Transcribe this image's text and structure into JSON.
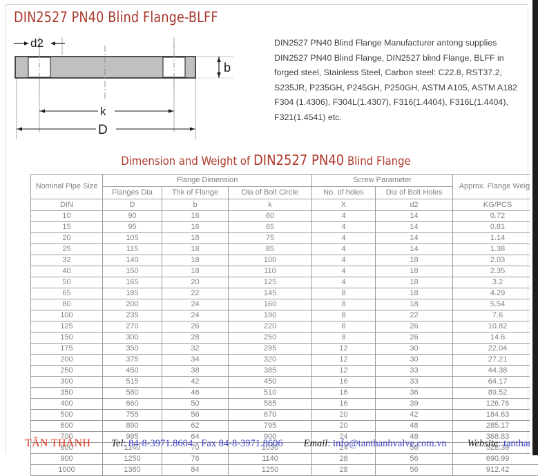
{
  "page": {
    "title": "DIN2527 PN40 Blind Flange-BLFF",
    "accent_color": "#a8392c",
    "heading_color": "#b03a2b"
  },
  "diagram": {
    "name": "blind-flange-cross-section",
    "labels": {
      "d2": "d2",
      "b": "b",
      "k": "k",
      "D": "D"
    }
  },
  "description": {
    "lines": [
      "DIN2527 PN40 Blind Flange Manufacturer antong supplies",
      "DIN2527 PN40 Blind Flange, DIN2527 blind Flange, BLFF in",
      "forged steel, Stainless Steel, Carbon steel: C22.8, RST37.2,",
      "S235JR, P235GH, P245GH, P250GH, ASTM A105, ASTM A182",
      "F304 (1.4306), F304L(1.4307), F316(1.4404), F316L(1.4404),",
      "F321(1.4541) etc."
    ]
  },
  "section_heading": {
    "prefix": "Dimension and Weight of ",
    "emphasis": "DIN2527 PN40",
    "suffix": " Blind Flange"
  },
  "table": {
    "group_headers": {
      "nominal_pipe_size": "Nominal Pipe Size",
      "flange_dimension": "Flange Dimension",
      "screw_parameter": "Screw Parameter",
      "approx_flange_weight": "Approx. Flange Weight"
    },
    "sub_headers": {
      "flanges_dia": "Flanges Dia",
      "thk_of_flange": "Thk of Flange",
      "dia_of_bolt_circle": "Dia of Bolt Circle",
      "no_of_holes": "No. of holes",
      "dia_of_bolt_holes": "Dia of Bolt Holes"
    },
    "symbol_row": [
      "DIN",
      "D",
      "b",
      "k",
      "X",
      "d2",
      "KG/PCS"
    ],
    "rows": [
      [
        "10",
        "90",
        "16",
        "60",
        "4",
        "14",
        "0.72"
      ],
      [
        "15",
        "95",
        "16",
        "65",
        "4",
        "14",
        "0.81"
      ],
      [
        "20",
        "105",
        "18",
        "75",
        "4",
        "14",
        "1.14"
      ],
      [
        "25",
        "115",
        "18",
        "85",
        "4",
        "14",
        "1.38"
      ],
      [
        "32",
        "140",
        "18",
        "100",
        "4",
        "18",
        "2.03"
      ],
      [
        "40",
        "150",
        "18",
        "110",
        "4",
        "18",
        "2.35"
      ],
      [
        "50",
        "165",
        "20",
        "125",
        "4",
        "18",
        "3.2"
      ],
      [
        "65",
        "185",
        "22",
        "145",
        "8",
        "18",
        "4.29"
      ],
      [
        "80",
        "200",
        "24",
        "160",
        "8",
        "18",
        "5.54"
      ],
      [
        "100",
        "235",
        "24",
        "190",
        "8",
        "22",
        "7.6"
      ],
      [
        "125",
        "270",
        "26",
        "220",
        "8",
        "26",
        "10.82"
      ],
      [
        "150",
        "300",
        "28",
        "250",
        "8",
        "26",
        "14.6"
      ],
      [
        "175",
        "350",
        "32",
        "295",
        "12",
        "30",
        "22.04"
      ],
      [
        "200",
        "375",
        "34",
        "320",
        "12",
        "30",
        "27.21"
      ],
      [
        "250",
        "450",
        "38",
        "385",
        "12",
        "33",
        "44.38"
      ],
      [
        "300",
        "515",
        "42",
        "450",
        "16",
        "33",
        "64.17"
      ],
      [
        "350",
        "580",
        "46",
        "510",
        "16",
        "36",
        "89.52"
      ],
      [
        "400",
        "660",
        "50",
        "585",
        "16",
        "39",
        "126.76"
      ],
      [
        "500",
        "755",
        "56",
        "670",
        "20",
        "42",
        "184.63"
      ],
      [
        "600",
        "890",
        "62",
        "795",
        "20",
        "48",
        "285.17"
      ],
      [
        "700",
        "995",
        "64",
        "900",
        "24",
        "48",
        "368.83"
      ],
      [
        "800",
        "1140",
        "70",
        "1030",
        "24",
        "56",
        "528.39"
      ],
      [
        "900",
        "1250",
        "76",
        "1140",
        "28",
        "56",
        "690.99"
      ],
      [
        "1000",
        "1360",
        "84",
        "1250",
        "28",
        "56",
        "912.42"
      ]
    ]
  },
  "footer": {
    "brand": "TÂN THÀNH",
    "tel_label": "Tel",
    "tel_value": ": 84-8-3971.8604 - Fax 84-8-3971.8606",
    "email_label": "Email",
    "email_value": ": info@tanthanhvalve.com.vn",
    "website_label": "Website",
    "website_value": ": tanthanhvalve.com.vn",
    "brand_color": "#e2341d",
    "value_color": "#3d42c8"
  }
}
